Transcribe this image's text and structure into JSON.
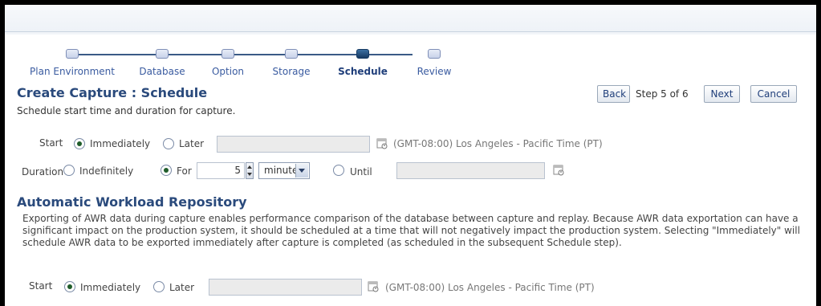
{
  "train": {
    "steps": [
      {
        "label": "Plan Environment"
      },
      {
        "label": "Database"
      },
      {
        "label": "Option"
      },
      {
        "label": "Storage"
      },
      {
        "label": "Schedule"
      },
      {
        "label": "Review"
      }
    ],
    "current_index": 4
  },
  "page": {
    "title": "Create Capture : Schedule",
    "subtitle": "Schedule start time and duration for capture."
  },
  "navigation": {
    "back_label": "Back",
    "step_text": "Step 5 of 6",
    "next_label": "Next",
    "cancel_label": "Cancel"
  },
  "capture_start": {
    "label": "Start",
    "immediately_label": "Immediately",
    "later_label": "Later",
    "selected": "Immediately",
    "date_value": "",
    "timezone": "(GMT-08:00) Los Angeles - Pacific Time (PT)"
  },
  "duration": {
    "label": "Duration",
    "indefinitely_label": "Indefinitely",
    "for_label": "For",
    "selected": "For",
    "amount": "5",
    "unit": "minutes",
    "until_label": "Until",
    "until_value": ""
  },
  "awr": {
    "title": "Automatic Workload Repository",
    "description": "Exporting of AWR data during capture enables performance comparison of the database between capture and replay. Because AWR data exportation can have a significant impact on the production system, it should be scheduled at a time that will not negatively impact the production system. Selecting \"Immediately\" will schedule AWR data to be exported immediately after capture is completed (as scheduled in the subsequent Schedule step).",
    "start_label": "Start",
    "immediately_label": "Immediately",
    "later_label": "Later",
    "selected": "Immediately",
    "date_value": "",
    "timezone": "(GMT-08:00) Los Angeles - Pacific Time (PT)"
  },
  "icons": {
    "calendar": "calendar-icon"
  },
  "colors": {
    "heading": "#2a4a7c",
    "train_current": "#163a63",
    "link": "#3a5ba0"
  }
}
